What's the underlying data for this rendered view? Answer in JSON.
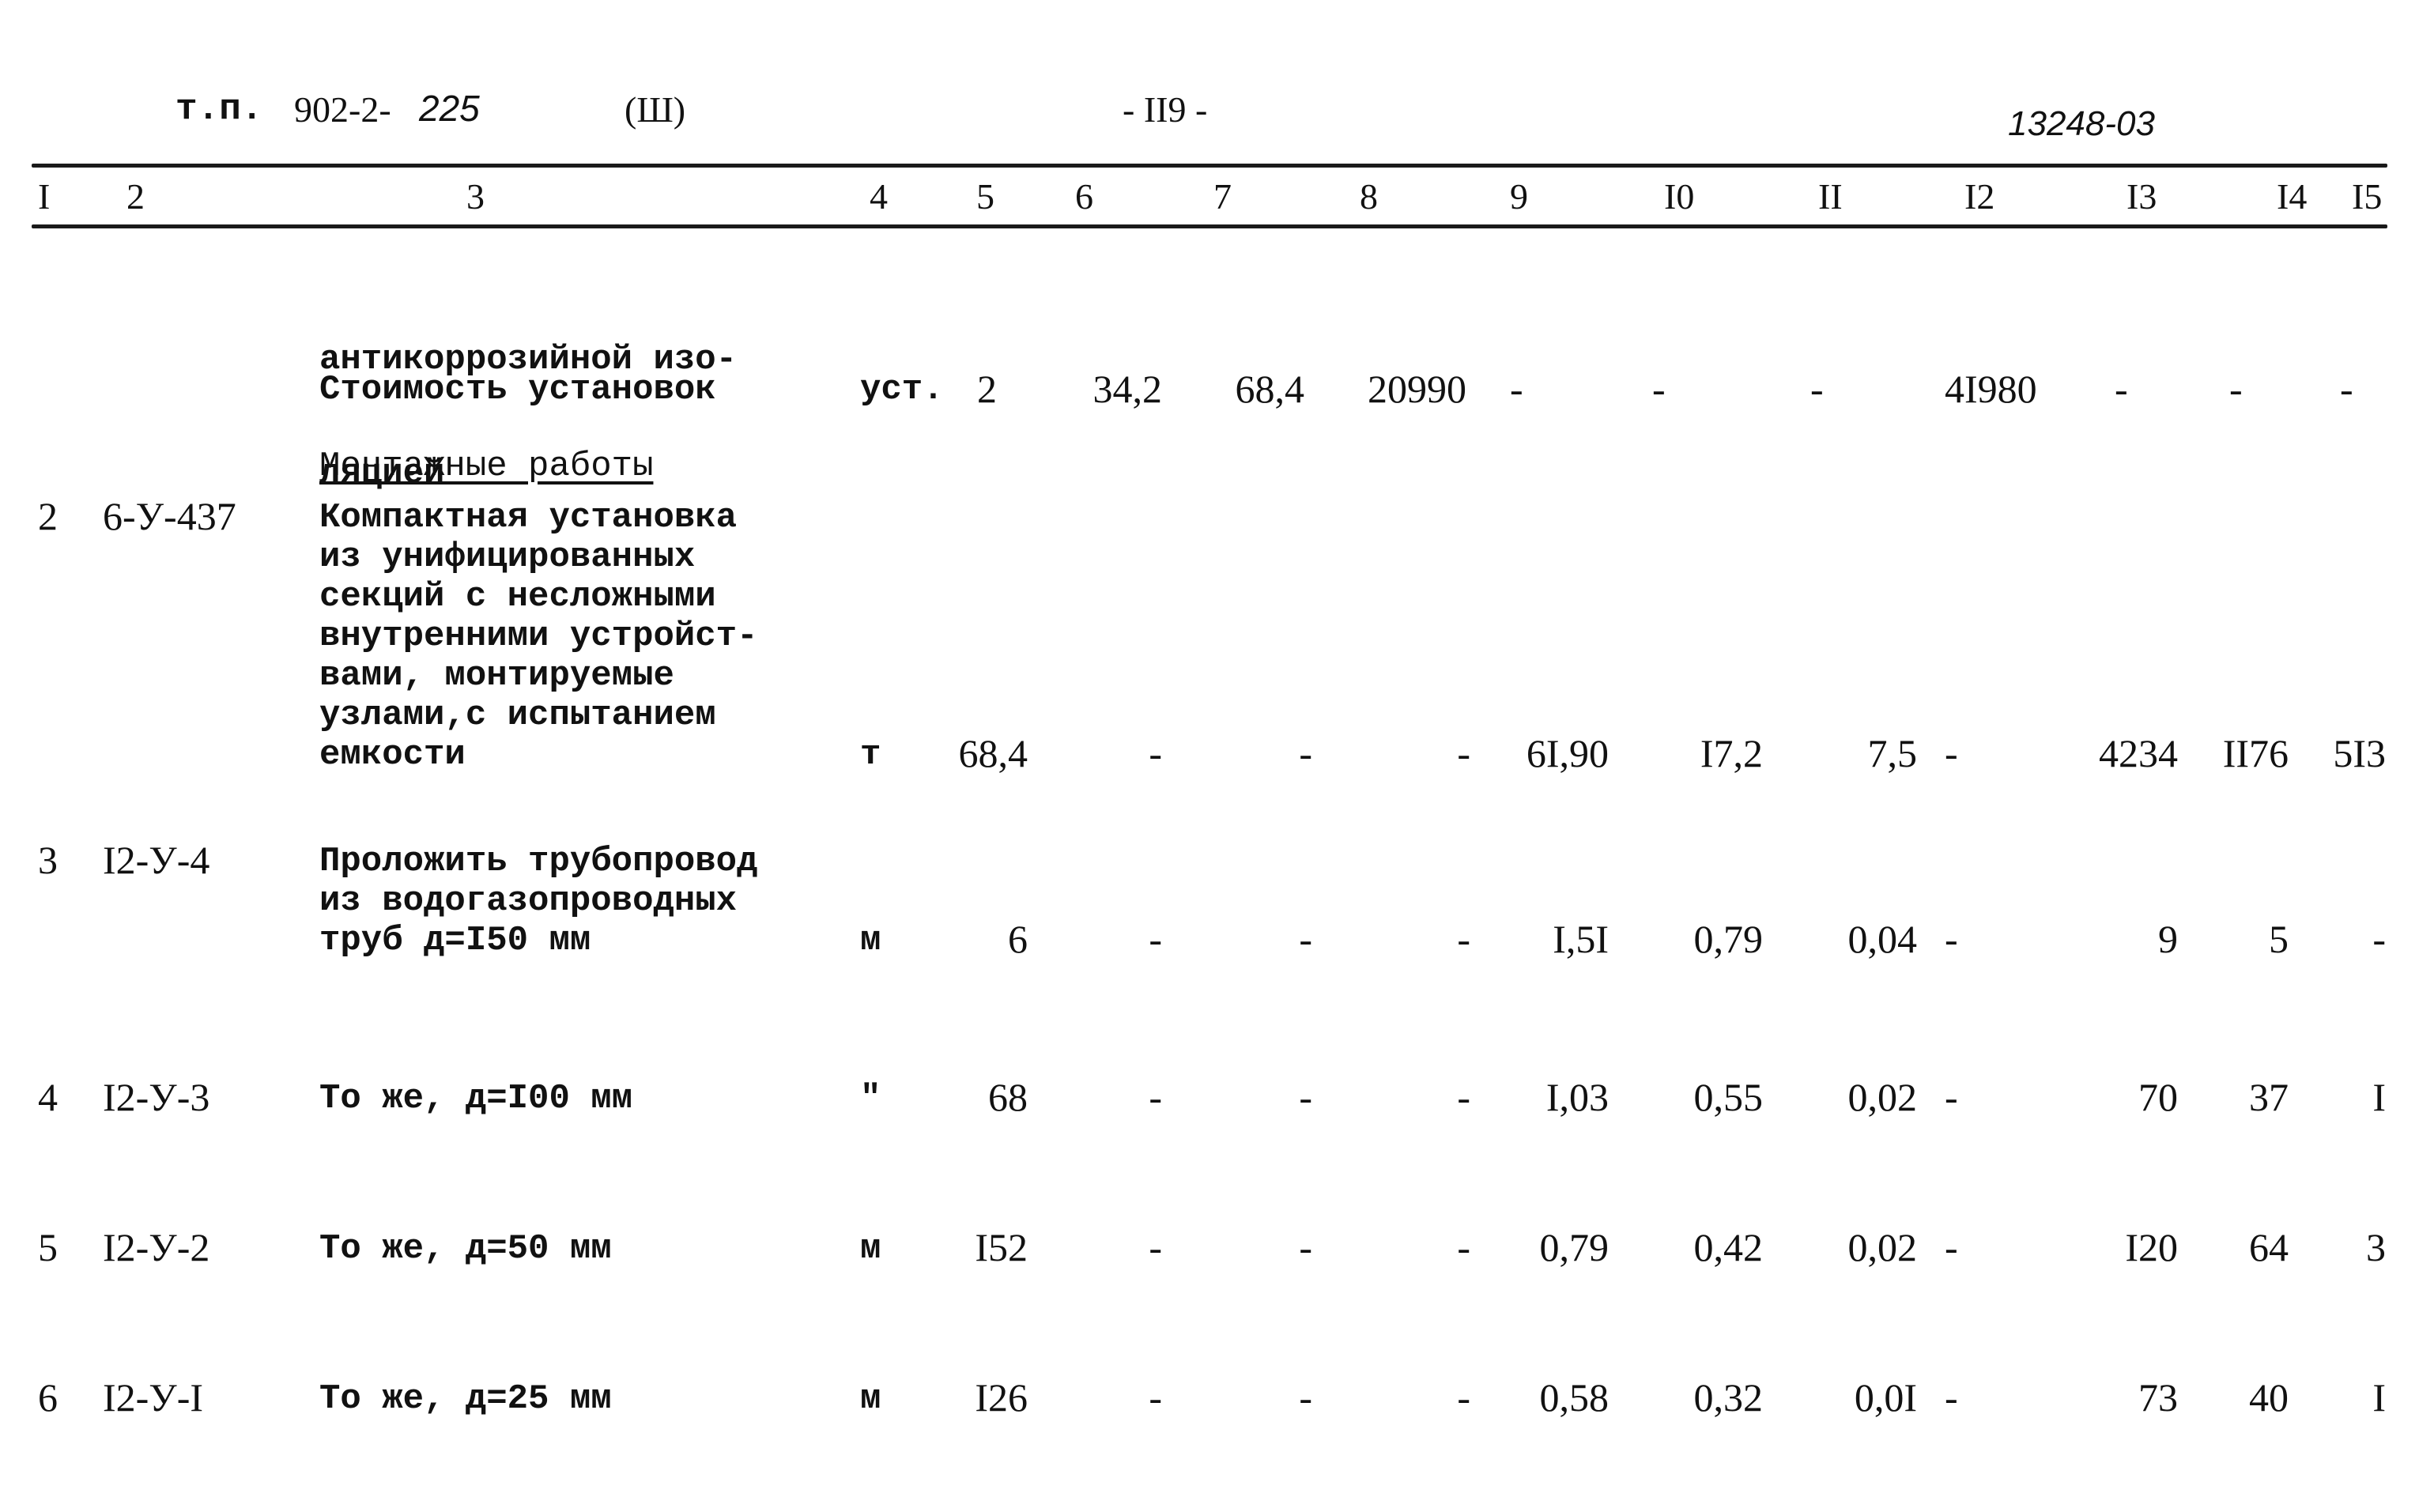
{
  "header": {
    "doc_prefix": "т.п.",
    "doc_number_typed": "902-2-",
    "doc_number_hand": "225",
    "volume": "(Ш)",
    "page": "- II9 -",
    "archive_number": "13248-03"
  },
  "column_numbers": [
    "I",
    "2",
    "3",
    "4",
    "5",
    "6",
    "7",
    "8",
    "9",
    "I0",
    "II",
    "I2",
    "I3",
    "I4",
    "I5"
  ],
  "continuation": {
    "description_lines": [
      "антикоррозийной изо-",
      "ляцией"
    ]
  },
  "cost_row": {
    "description": "Стоимость установок",
    "unit": "уст.",
    "qty": "2",
    "c6": "34,2",
    "c7": "68,4",
    "c8": "20990",
    "c9": "-",
    "c10": "-",
    "c11": "-",
    "c12": "4I980",
    "c13": "-",
    "c14": "-",
    "c15": "-"
  },
  "section_heading": "Монтажные работы",
  "rows": [
    {
      "n": "2",
      "code": "6-У-437",
      "description_lines": [
        "Компактная установка",
        "из унифицированных",
        "секций с несложными",
        "внутренними устройст-",
        "вами, монтируемые",
        "узлами,с испытанием",
        "емкости"
      ],
      "unit": "т",
      "qty": "68,4",
      "c6": "-",
      "c7": "-",
      "c8": "-",
      "c9": "6I,90",
      "c10": "I7,2",
      "c11": "7,5",
      "c12": "-",
      "c13": "4234",
      "c14": "II76",
      "c15": "5I3"
    },
    {
      "n": "3",
      "code": "I2-У-4",
      "description_lines": [
        "Проложить трубопровод",
        "из водогазопроводных",
        "труб д=I50 мм"
      ],
      "unit": "м",
      "qty": "6",
      "c6": "-",
      "c7": "-",
      "c8": "-",
      "c9": "I,5I",
      "c10": "0,79",
      "c11": "0,04",
      "c12": "-",
      "c13": "9",
      "c14": "5",
      "c15": "-"
    },
    {
      "n": "4",
      "code": "I2-У-3",
      "description_lines": [
        "То же, д=I00 мм"
      ],
      "unit": "\"",
      "qty": "68",
      "c6": "-",
      "c7": "-",
      "c8": "-",
      "c9": "I,03",
      "c10": "0,55",
      "c11": "0,02",
      "c12": "-",
      "c13": "70",
      "c14": "37",
      "c15": "I"
    },
    {
      "n": "5",
      "code": "I2-У-2",
      "description_lines": [
        "То же, д=50 мм"
      ],
      "unit": "м",
      "qty": "I52",
      "c6": "-",
      "c7": "-",
      "c8": "-",
      "c9": "0,79",
      "c10": "0,42",
      "c11": "0,02",
      "c12": "-",
      "c13": "I20",
      "c14": "64",
      "c15": "3"
    },
    {
      "n": "6",
      "code": "I2-У-I",
      "description_lines": [
        "То же, д=25 мм"
      ],
      "unit": "м",
      "qty": "I26",
      "c6": "-",
      "c7": "-",
      "c8": "-",
      "c9": "0,58",
      "c10": "0,32",
      "c11": "0,0I",
      "c12": "-",
      "c13": "73",
      "c14": "40",
      "c15": "I"
    }
  ]
}
